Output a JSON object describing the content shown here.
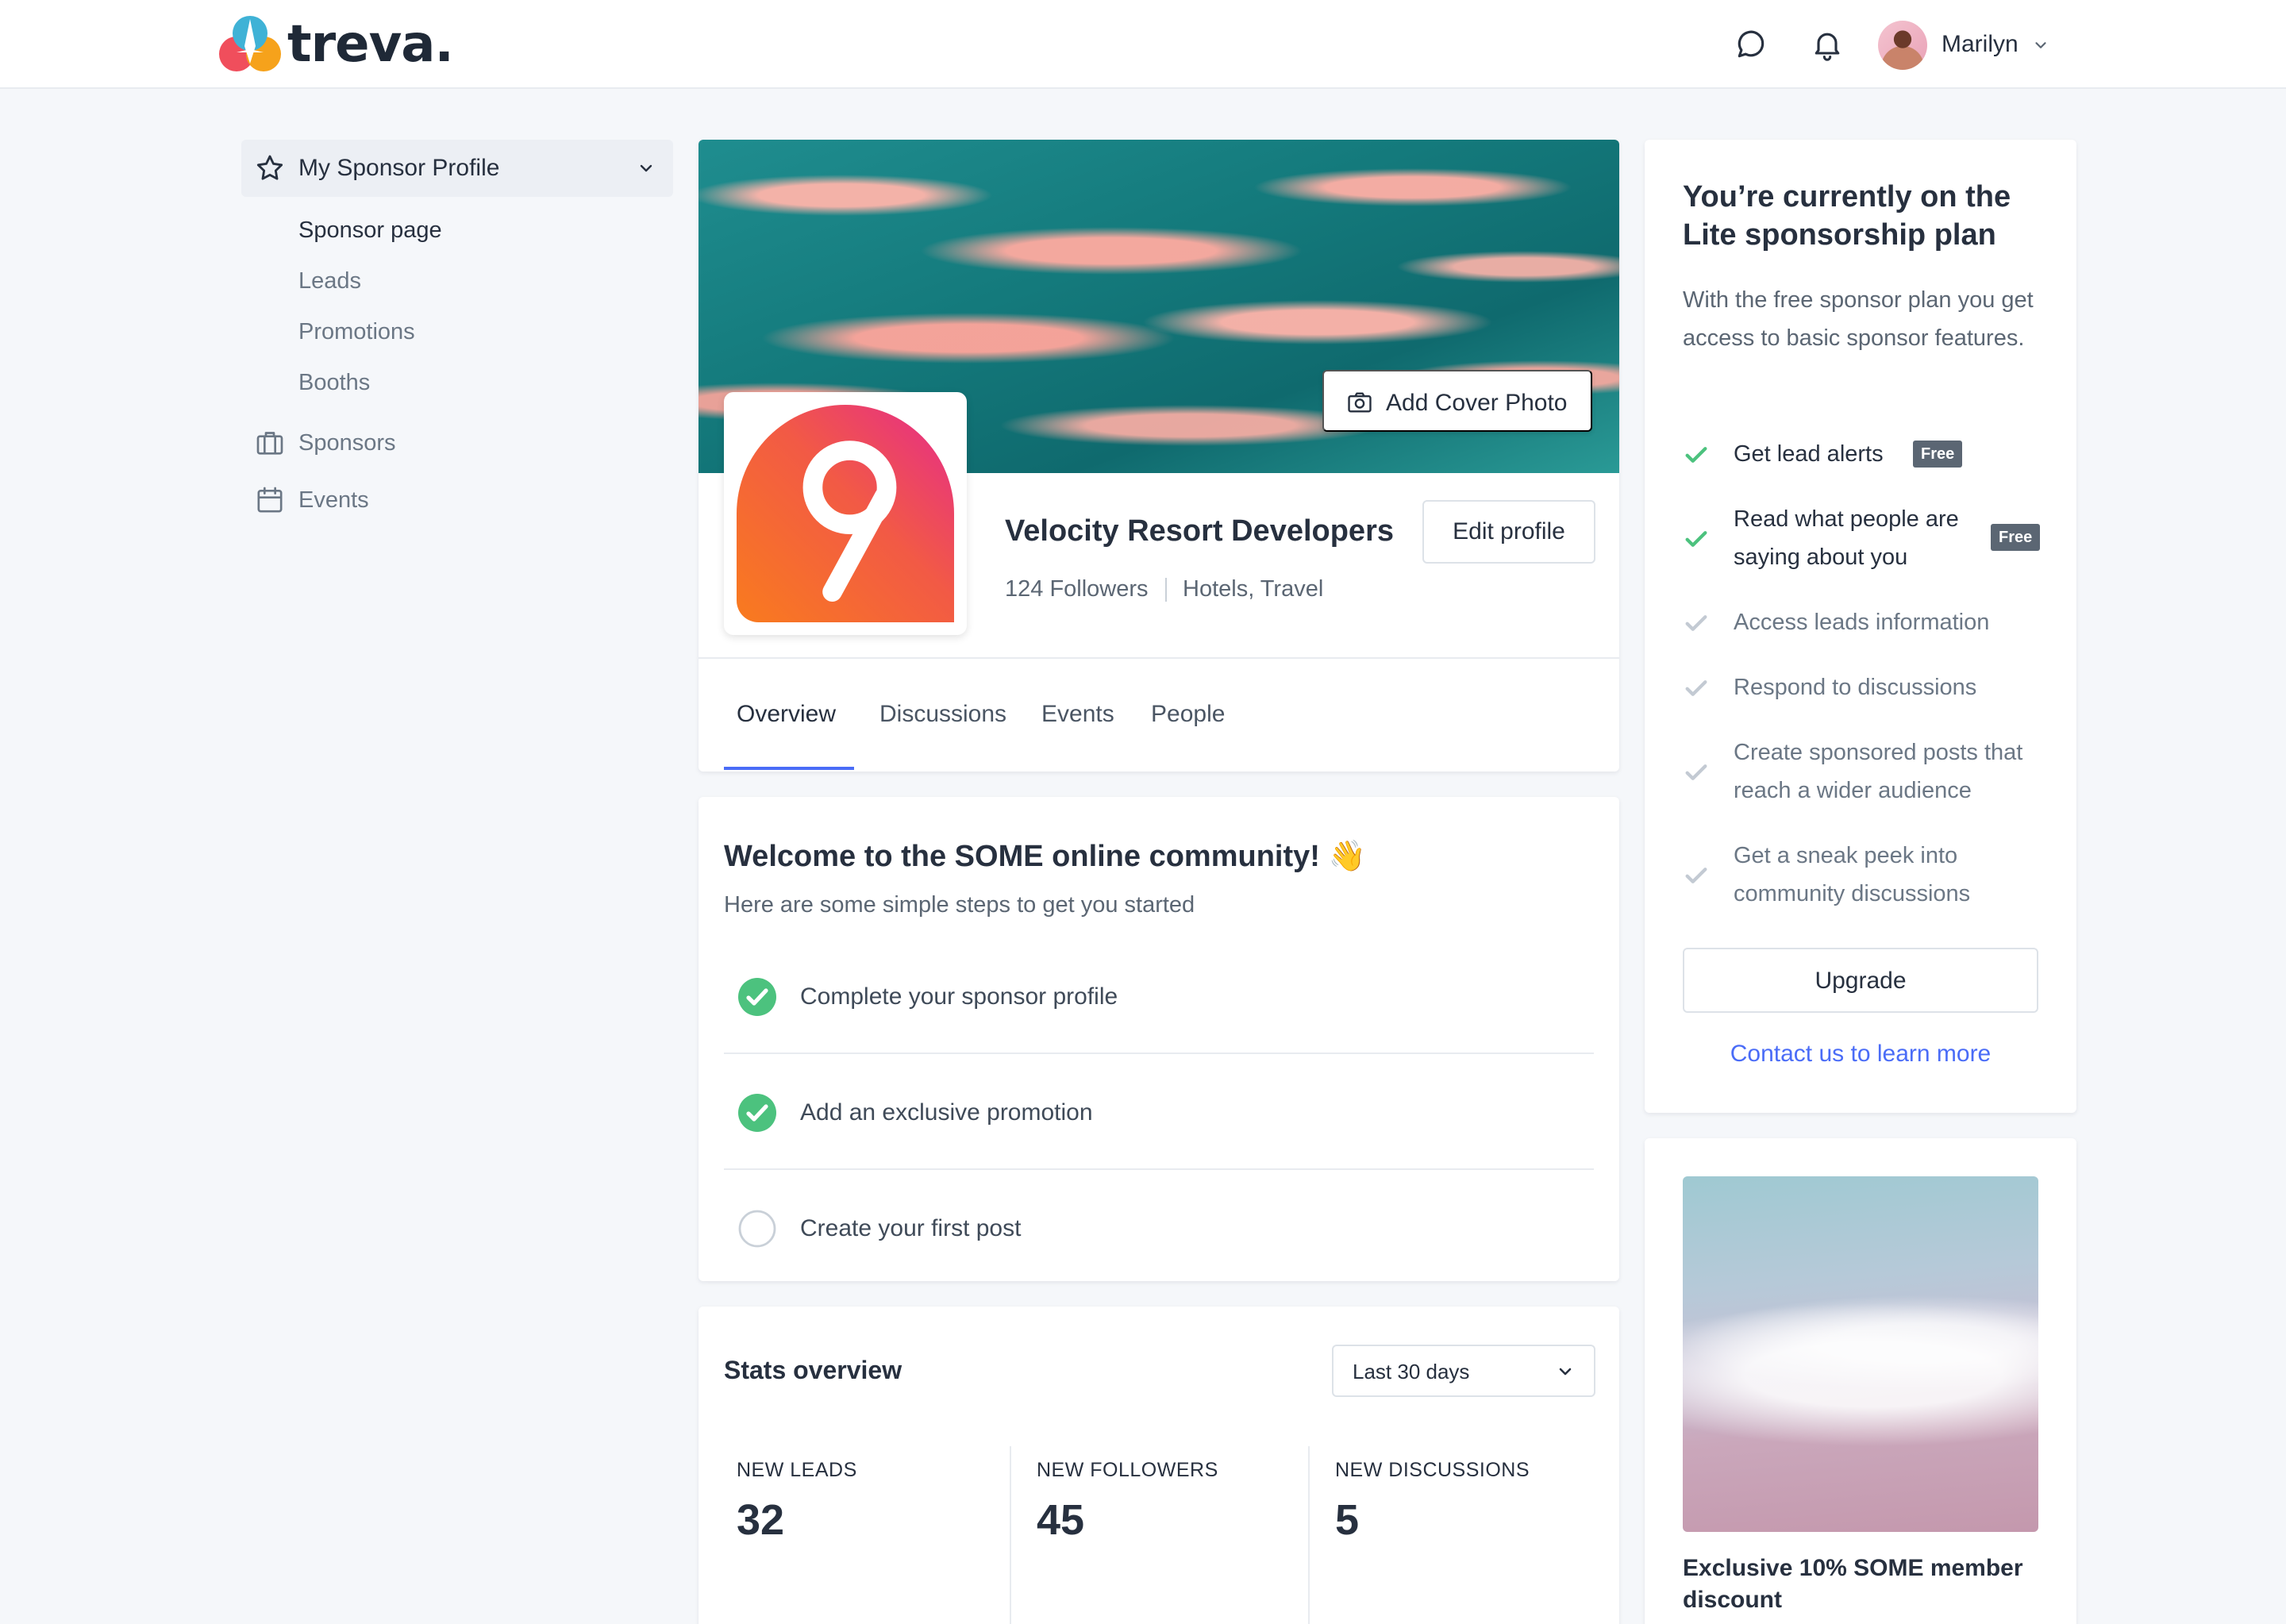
{
  "header": {
    "logo_text": "treva.",
    "user_name": "Marilyn",
    "icons": [
      "chat-icon",
      "bell-icon"
    ]
  },
  "sidebar": {
    "section_label": "My Sponsor Profile",
    "sub_items": [
      {
        "label": "Sponsor page",
        "active": true
      },
      {
        "label": "Leads",
        "active": false
      },
      {
        "label": "Promotions",
        "active": false
      },
      {
        "label": "Booths",
        "active": false
      }
    ],
    "items": [
      {
        "label": "Sponsors",
        "icon": "briefcase-icon"
      },
      {
        "label": "Events",
        "icon": "calendar-icon"
      }
    ]
  },
  "profile": {
    "add_cover_label": "Add Cover Photo",
    "company_name": "Velocity Resort Developers",
    "followers": "124 Followers",
    "categories": "Hotels, Travel",
    "edit_label": "Edit profile",
    "tabs": [
      "Overview",
      "Discussions",
      "Events",
      "People"
    ],
    "active_tab": "Overview"
  },
  "welcome": {
    "title": "Welcome to the SOME online community! 👋",
    "subtitle": "Here are some simple steps to get you started",
    "steps": [
      {
        "label": "Complete your sponsor profile",
        "done": true
      },
      {
        "label": "Add an exclusive promotion",
        "done": true
      },
      {
        "label": "Create your first post",
        "done": false
      }
    ]
  },
  "stats": {
    "title": "Stats overview",
    "range": "Last 30 days",
    "items": [
      {
        "label": "NEW LEADS",
        "value": "32"
      },
      {
        "label": "NEW FOLLOWERS",
        "value": "45"
      },
      {
        "label": "NEW DISCUSSIONS",
        "value": "5"
      }
    ]
  },
  "plan": {
    "title": "You’re currently on the Lite sponsorship plan",
    "description": "With the free sponsor plan you get access to basic sponsor features.",
    "features": [
      {
        "label": "Get lead alerts",
        "included": true,
        "badge": "Free"
      },
      {
        "label": "Read what people are saying about you",
        "included": true,
        "badge": "Free"
      },
      {
        "label": "Access leads information",
        "included": false
      },
      {
        "label": "Respond to discussions",
        "included": false
      },
      {
        "label": "Create sponsored posts that reach a wider audience",
        "included": false
      },
      {
        "label": "Get a sneak peek into community discussions",
        "included": false
      }
    ],
    "upgrade_label": "Upgrade",
    "contact_label": "Contact us to learn more"
  },
  "promo": {
    "title": "Exclusive 10% SOME member discount"
  },
  "colors": {
    "accent": "#4a6cf7",
    "success": "#4cc27e",
    "background": "#f5f7fa"
  }
}
